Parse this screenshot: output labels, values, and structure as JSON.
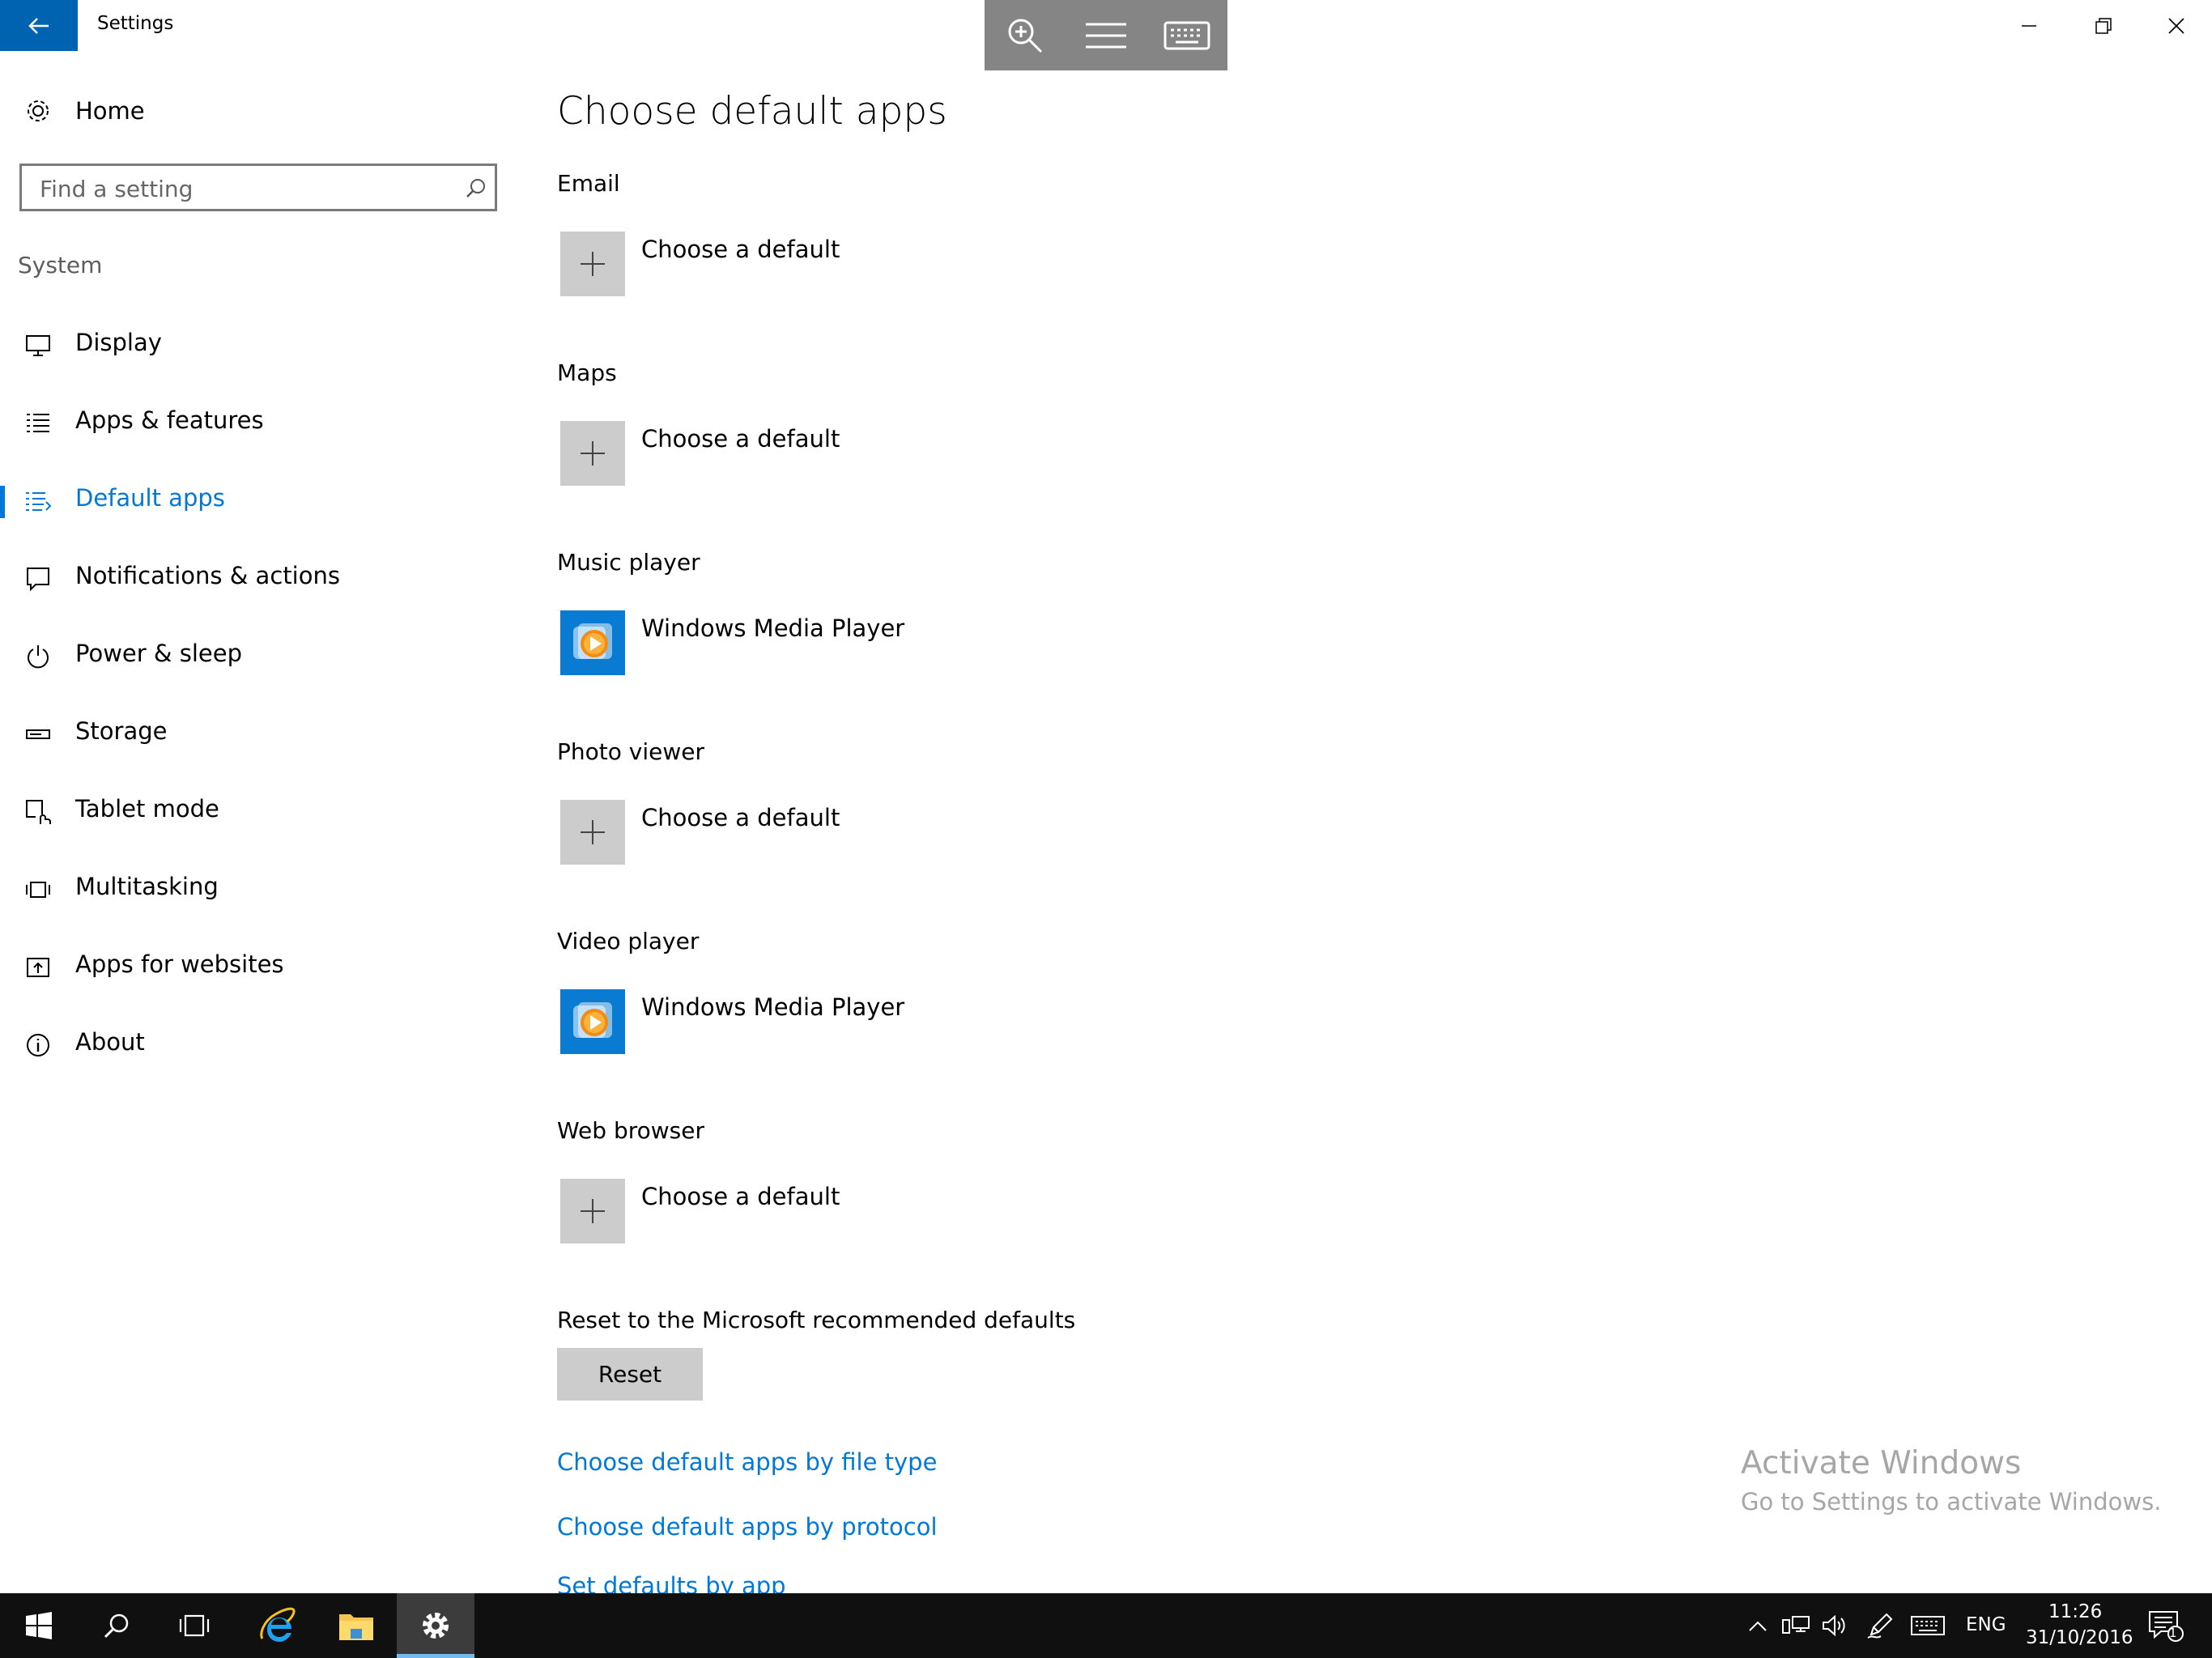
{
  "window": {
    "title": "Settings",
    "controls": [
      "minimize",
      "restore",
      "close"
    ]
  },
  "overlay_toolbar": {
    "items": [
      "magnifier-icon",
      "menu-icon",
      "keyboard-icon"
    ]
  },
  "sidebar": {
    "home_label": "Home",
    "search": {
      "placeholder": "Find a setting"
    },
    "section_label": "System",
    "items": [
      {
        "label": "Display",
        "icon": "monitor-icon",
        "active": false
      },
      {
        "label": "Apps & features",
        "icon": "list-icon",
        "active": false
      },
      {
        "label": "Default apps",
        "icon": "default-apps-icon",
        "active": true
      },
      {
        "label": "Notifications & actions",
        "icon": "notification-icon",
        "active": false
      },
      {
        "label": "Power & sleep",
        "icon": "power-icon",
        "active": false
      },
      {
        "label": "Storage",
        "icon": "storage-icon",
        "active": false
      },
      {
        "label": "Tablet mode",
        "icon": "tablet-mode-icon",
        "active": false
      },
      {
        "label": "Multitasking",
        "icon": "multitasking-icon",
        "active": false
      },
      {
        "label": "Apps for websites",
        "icon": "apps-for-websites-icon",
        "active": false
      },
      {
        "label": "About",
        "icon": "info-icon",
        "active": false
      }
    ]
  },
  "main": {
    "title": "Choose default apps",
    "groups": [
      {
        "label": "Email",
        "app": "Choose a default",
        "icon": "plus-icon"
      },
      {
        "label": "Maps",
        "app": "Choose a default",
        "icon": "plus-icon"
      },
      {
        "label": "Music player",
        "app": "Windows Media Player",
        "icon": "windows-media-player-icon"
      },
      {
        "label": "Photo viewer",
        "app": "Choose a default",
        "icon": "plus-icon"
      },
      {
        "label": "Video player",
        "app": "Windows Media Player",
        "icon": "windows-media-player-icon"
      },
      {
        "label": "Web browser",
        "app": "Choose a default",
        "icon": "plus-icon"
      }
    ],
    "reset_label": "Reset to the Microsoft recommended defaults",
    "reset_button": "Reset",
    "links": [
      "Choose default apps by file type",
      "Choose default apps by protocol",
      "Set defaults by app"
    ]
  },
  "watermark": {
    "title": "Activate Windows",
    "subtitle": "Go to Settings to activate Windows."
  },
  "taskbar": {
    "buttons": [
      "windows-start-icon",
      "search-icon",
      "task-view-icon",
      "internet-explorer-icon",
      "file-explorer-icon",
      "settings-icon"
    ],
    "active_button": "settings-icon",
    "tray": {
      "language": "ENG",
      "time": "11:26",
      "date": "31/10/2016",
      "notification_count": "1"
    }
  },
  "colors": {
    "accent": "#0078d7",
    "back_button": "#0063b1",
    "taskbar": "#101010",
    "tile_gray": "#cccccc",
    "watermark": "#a6a6a6"
  }
}
